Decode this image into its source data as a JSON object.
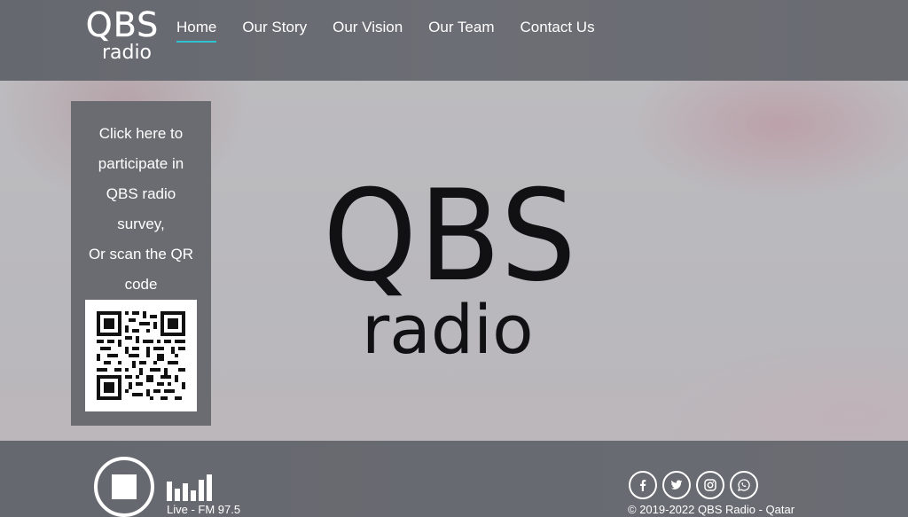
{
  "header": {
    "logo": {
      "top": "QBS",
      "bottom": "radio"
    },
    "nav": [
      {
        "label": "Home",
        "active": true
      },
      {
        "label": "Our Story",
        "active": false
      },
      {
        "label": "Our Vision",
        "active": false
      },
      {
        "label": "Our Team",
        "active": false
      },
      {
        "label": "Contact Us",
        "active": false
      }
    ],
    "active_underline_color": "#2fc3d2"
  },
  "survey": {
    "lines": [
      "Click here to",
      "participate in",
      "QBS radio",
      "survey,",
      "Or scan the QR",
      "code"
    ],
    "qr_icon": "qr-code"
  },
  "hero": {
    "logo_top": "QBS",
    "logo_bottom": "radio"
  },
  "player": {
    "control_icon": "stop-icon",
    "equalizer_icon": "equalizer-icon",
    "station_label": "Live - FM 97.5"
  },
  "footer": {
    "socials": [
      {
        "name": "facebook-icon",
        "glyph": "f"
      },
      {
        "name": "twitter-icon",
        "glyph": "t"
      },
      {
        "name": "instagram-icon",
        "glyph": "ig"
      },
      {
        "name": "whatsapp-icon",
        "glyph": "wa"
      }
    ],
    "copyright": "© 2019-2022 QBS Radio - Qatar"
  }
}
